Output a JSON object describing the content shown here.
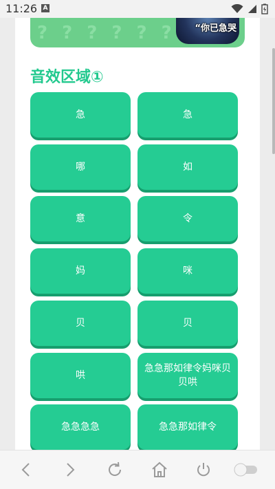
{
  "status_bar": {
    "time": "11:26",
    "notification_icon": "A"
  },
  "banner": {
    "pattern_text": "? ? ? ? ? ? ?",
    "caption": "“你已急哭"
  },
  "section": {
    "title": "音效区域①"
  },
  "sound_buttons": [
    {
      "label": "急"
    },
    {
      "label": "急"
    },
    {
      "label": "哪"
    },
    {
      "label": "如"
    },
    {
      "label": "意"
    },
    {
      "label": "令"
    },
    {
      "label": "妈"
    },
    {
      "label": "咪"
    },
    {
      "label": "贝"
    },
    {
      "label": "贝"
    },
    {
      "label": "哄"
    },
    {
      "label": "急急那如律令妈咪贝贝哄"
    },
    {
      "label": "急急急急"
    },
    {
      "label": "急急那如律令"
    }
  ],
  "colors": {
    "accent": "#22c98e",
    "button": "#25cc93",
    "button_shadow": "#179e6e",
    "banner": "#6ccf8b"
  },
  "bottom_nav": {
    "icons": [
      "back-icon",
      "forward-icon",
      "reload-icon",
      "home-icon",
      "power-icon",
      "toggle-switch"
    ]
  }
}
